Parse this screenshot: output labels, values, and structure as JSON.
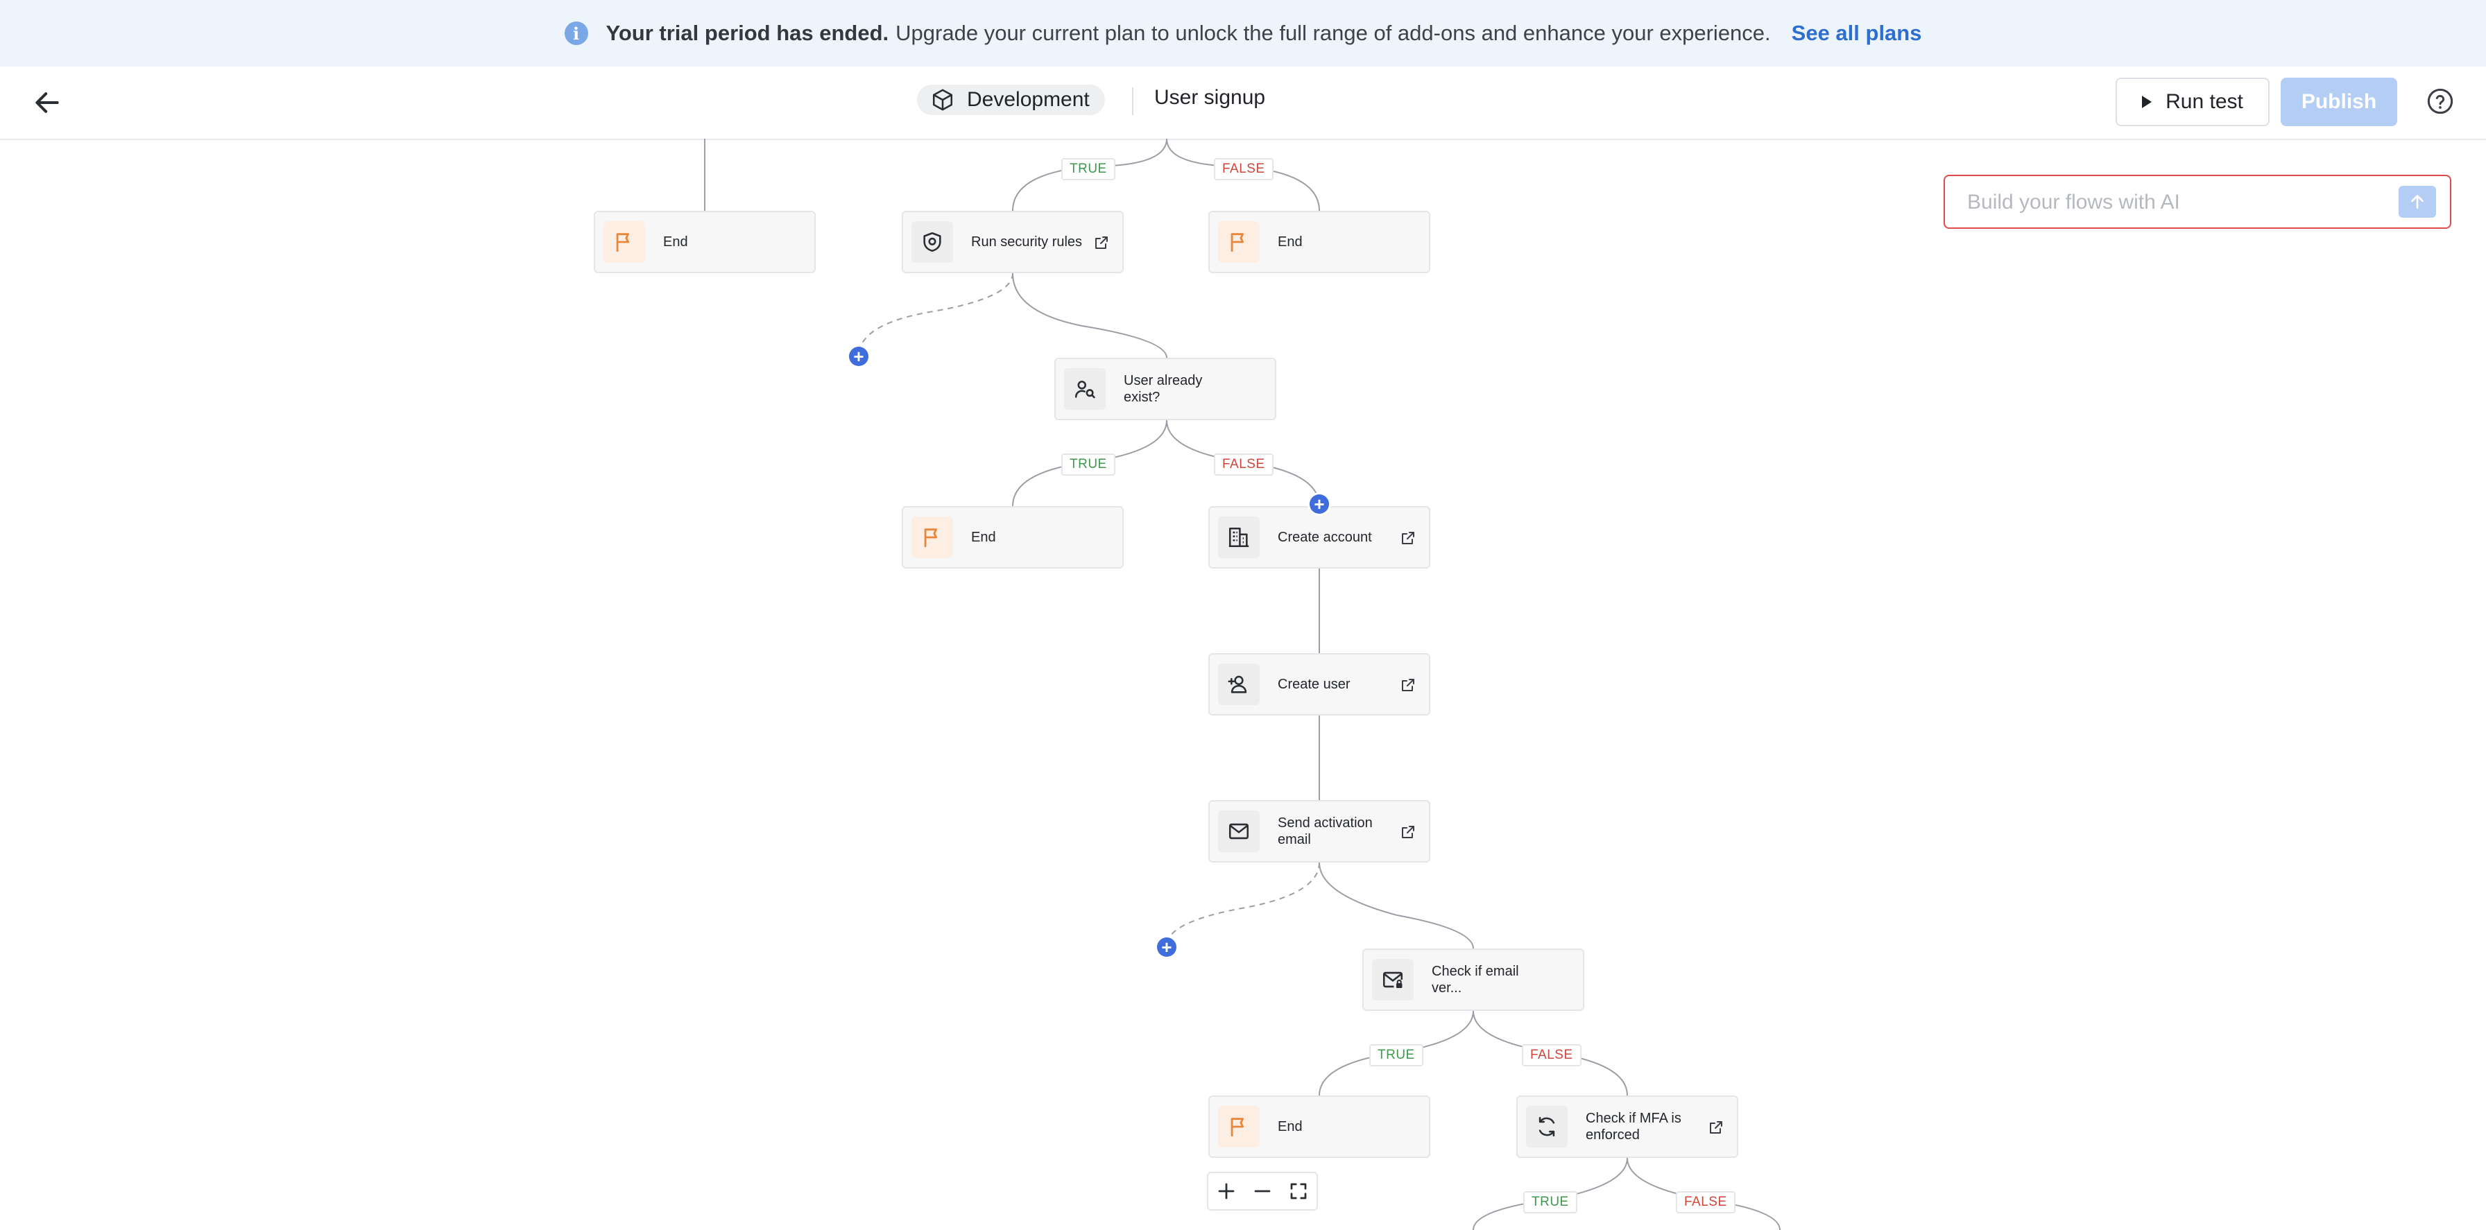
{
  "banner": {
    "strong": "Your trial period has ended.",
    "text": "Upgrade your current plan to unlock the full range of add-ons and enhance your experience.",
    "link": "See all plans"
  },
  "header": {
    "environment": "Development",
    "flow_name": "User signup",
    "run_test": "Run test",
    "publish": "Publish"
  },
  "ai_prompt": {
    "placeholder": "Build your flows with AI"
  },
  "nodes": {
    "end_1": "End",
    "security": "Run security rules",
    "end_2": "End",
    "user_exists": "User already exist?",
    "end_3": "End",
    "create_account": "Create account",
    "create_user": "Create user",
    "activation": "Send activation email",
    "check_email": "Check if email ver...",
    "end_4": "End",
    "check_mfa": "Check if MFA is enforced"
  },
  "branches": {
    "true": "TRUE",
    "false": "FALSE"
  },
  "icons": {
    "banner": "info-icon",
    "back": "arrow-left-icon",
    "env": "cube-icon",
    "run": "play-icon",
    "help": "help-circle-icon",
    "send": "arrow-up-icon",
    "end": "flag-icon",
    "security": "shield-icon",
    "user_exists": "user-search-icon",
    "account": "building-icon",
    "user": "user-plus-icon",
    "email": "mail-icon",
    "email_check": "mail-lock-icon",
    "mfa": "refresh-icon",
    "external": "external-link-icon"
  },
  "colors": {
    "accent": "#3f6ddc",
    "true": "#3c9a4b",
    "false": "#d2453b",
    "flag": "#e8873a"
  }
}
